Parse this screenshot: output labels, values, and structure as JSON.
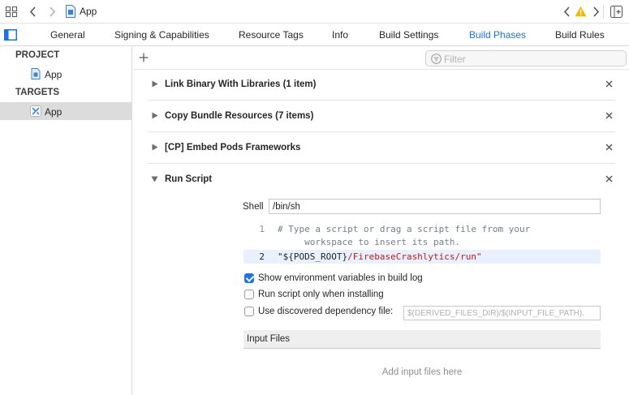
{
  "window": {
    "title": "App",
    "file_icon": "file-icon",
    "warning_icon": "warning-triangle-icon"
  },
  "tabs": [
    {
      "label": "General",
      "active": false
    },
    {
      "label": "Signing & Capabilities",
      "active": false
    },
    {
      "label": "Resource Tags",
      "active": false
    },
    {
      "label": "Info",
      "active": false
    },
    {
      "label": "Build Settings",
      "active": false
    },
    {
      "label": "Build Phases",
      "active": true
    },
    {
      "label": "Build Rules",
      "active": false
    }
  ],
  "sidebar": {
    "project_header": "PROJECT",
    "project_item": "App",
    "targets_header": "TARGETS",
    "target_item": "App"
  },
  "filter": {
    "placeholder": "Filter"
  },
  "phases": [
    {
      "title": "Link Binary With Libraries (1 item)",
      "expanded": false
    },
    {
      "title": "Copy Bundle Resources (7 items)",
      "expanded": false
    },
    {
      "title": "[CP] Embed Pods Frameworks",
      "expanded": false
    },
    {
      "title": "Run Script",
      "expanded": true
    }
  ],
  "run_script": {
    "shell_label": "Shell",
    "shell_value": "/bin/sh",
    "lines": [
      {
        "num": "1",
        "comment_1": "# Type a script or drag a script file from your",
        "comment_2": "     workspace to insert its path."
      },
      {
        "num": "2",
        "code_plain": "\"${PODS_ROOT}",
        "code_str": "/FirebaseCrashlytics/run\""
      }
    ],
    "options": [
      {
        "label": "Show environment variables in build log",
        "checked": true
      },
      {
        "label": "Run script only when installing",
        "checked": false
      },
      {
        "label": "Use discovered dependency file:",
        "checked": false
      }
    ],
    "dependency_placeholder": "$(DERIVED_FILES_DIR)/$(INPUT_FILE_PATH).",
    "input_files_header": "Input Files",
    "input_files_empty": "Add input files here"
  },
  "colors": {
    "accent": "#1a73e8",
    "selection": "#dcdcdc",
    "string": "#c41a16",
    "comment": "#707f8c"
  }
}
